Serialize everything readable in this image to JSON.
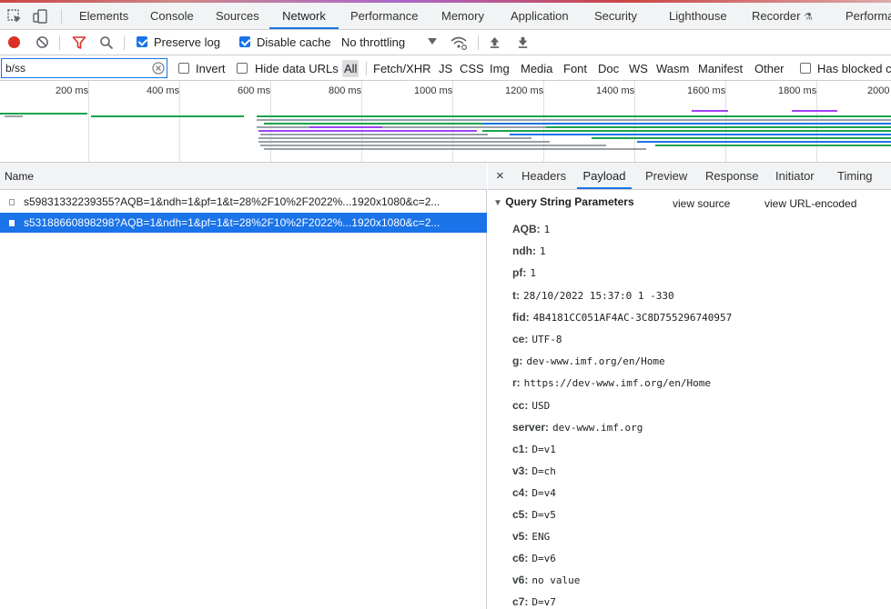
{
  "devtools": {
    "tabs": [
      "Elements",
      "Console",
      "Sources",
      "Network",
      "Performance",
      "Memory",
      "Application",
      "Security",
      "Lighthouse",
      "Recorder",
      "Performa"
    ],
    "active_tab": "Network"
  },
  "toolbar": {
    "preserve_log": "Preserve log",
    "disable_cache": "Disable cache",
    "throttling": "No throttling"
  },
  "filter": {
    "value": "b/ss",
    "invert": "Invert",
    "hide_data_urls": "Hide data URLs",
    "types": [
      "All",
      "Fetch/XHR",
      "JS",
      "CSS",
      "Img",
      "Media",
      "Font",
      "Doc",
      "WS",
      "Wasm",
      "Manifest",
      "Other"
    ],
    "has_blocked": "Has blocked c"
  },
  "timeline": {
    "ticks": [
      "200 ms",
      "400 ms",
      "600 ms",
      "800 ms",
      "1000 ms",
      "1200 ms",
      "1400 ms",
      "1600 ms",
      "1800 ms",
      "2000"
    ]
  },
  "requests": {
    "column": "Name",
    "rows": [
      {
        "name": "s59831332239355?AQB=1&ndh=1&pf=1&t=28%2F10%2F2022%...1920x1080&c=2..."
      },
      {
        "name": "s53188660898298?AQB=1&ndh=1&pf=1&t=28%2F10%2F2022%...1920x1080&c=2..."
      }
    ]
  },
  "detail": {
    "close": "×",
    "tabs": [
      "Headers",
      "Payload",
      "Preview",
      "Response",
      "Initiator",
      "Timing"
    ],
    "active_tab": "Payload",
    "section_title": "Query String Parameters",
    "view_source": "view source",
    "view_url_encoded": "view URL-encoded",
    "params": [
      {
        "k": "AQB:",
        "v": "1"
      },
      {
        "k": "ndh:",
        "v": "1"
      },
      {
        "k": "pf:",
        "v": "1"
      },
      {
        "k": "t:",
        "v": "28/10/2022 15:37:0 1 -330"
      },
      {
        "k": "fid:",
        "v": "4B4181CC051AF4AC-3C8D755296740957"
      },
      {
        "k": "ce:",
        "v": "UTF-8"
      },
      {
        "k": "g:",
        "v": "dev-www.imf.org/en/Home"
      },
      {
        "k": "r:",
        "v": "https://dev-www.imf.org/en/Home"
      },
      {
        "k": "cc:",
        "v": "USD"
      },
      {
        "k": "server:",
        "v": "dev-www.imf.org"
      },
      {
        "k": "c1:",
        "v": "D=v1"
      },
      {
        "k": "v3:",
        "v": "D=ch"
      },
      {
        "k": "c4:",
        "v": "D=v4"
      },
      {
        "k": "c5:",
        "v": "D=v5"
      },
      {
        "k": "v5:",
        "v": "ENG"
      },
      {
        "k": "c6:",
        "v": "D=v6"
      },
      {
        "k": "v6:",
        "v": "no value"
      },
      {
        "k": "c7:",
        "v": "D=v7"
      }
    ]
  },
  "colors": {
    "accent": "#1a73e8",
    "record": "#d93025",
    "filter_icon": "#d93025"
  }
}
